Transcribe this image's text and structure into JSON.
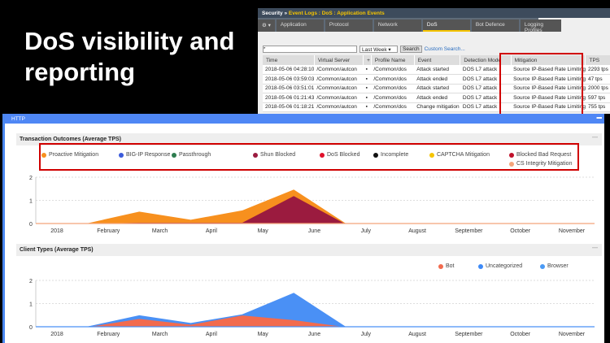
{
  "slide_title": "DoS visibility and reporting",
  "console": {
    "breadcrumb_root": "Security",
    "breadcrumb_sep": "»",
    "breadcrumb_path": "Event Logs : DoS : Application Events",
    "tabs": [
      "Application",
      "Protocol",
      "Network",
      "DoS",
      "Bot Defence",
      "Logging Profiles"
    ],
    "active_tab": "DoS",
    "gear": "⚙ ▾",
    "search_value": "*",
    "period": "Last Week ▾",
    "search_label": "Search",
    "custom_search": "Custom Search...",
    "columns": [
      "Time",
      "Virtual Server",
      "+",
      "Profile Name",
      "Event",
      "Detection Mode",
      "Mitigation",
      "TPS"
    ],
    "rows": [
      [
        "2018-05-06 04:28:10",
        "/Common/autcon",
        "/Common/dos",
        "Attack started",
        "DOS L7 attack",
        "Source IP-Based Rate Limiting",
        "2293 tps"
      ],
      [
        "2018-05-06 03:59:03",
        "/Common/autcon",
        "/Common/dos",
        "Attack ended",
        "DOS L7 attack",
        "Source IP-Based Rate Limiting",
        "47 tps"
      ],
      [
        "2018-05-06 03:51:01",
        "/Common/autcon",
        "/Common/dos",
        "Attack started",
        "DOS L7 attack",
        "Source IP-Based Rate Limiting",
        "2000 tps"
      ],
      [
        "2018-05-06 01:21:43",
        "/Common/autcon",
        "/Common/dos",
        "Attack ended",
        "DOS L7 attack",
        "Source IP-Based Rate Limiting",
        "597 tps"
      ],
      [
        "2018-05-06 01:18:21",
        "/Common/autcon",
        "/Common/dos",
        "Change mitigation",
        "DOS L7 attack",
        "Source IP-Based Rate Limiting",
        "755 tps"
      ]
    ]
  },
  "panel": {
    "title": "HTTP",
    "collapse": "▬"
  },
  "chart_data": [
    {
      "type": "area",
      "title": "Transaction Outcomes (Average TPS)",
      "stacked": true,
      "x_ticks": [
        "2018",
        "February",
        "March",
        "April",
        "May",
        "June",
        "July",
        "August",
        "September",
        "October",
        "November"
      ],
      "y_ticks": [
        "0",
        "1",
        "2"
      ],
      "ylim": [
        0,
        2
      ],
      "x": [
        0.6,
        1.6,
        2.6,
        3.6,
        4.6,
        5.6
      ],
      "legend": [
        {
          "name": "Proactive Mitigation",
          "color": "#f7901e"
        },
        {
          "name": "BIG-IP Response",
          "color": "#3b5bdb"
        },
        {
          "name": "Passthrough",
          "color": "#2e7d4f"
        },
        {
          "name": "Shun Blocked",
          "color": "#9b1b3f"
        },
        {
          "name": "DoS Blocked",
          "color": "#e0102a"
        },
        {
          "name": "Incomplete",
          "color": "#111111"
        },
        {
          "name": "CAPTCHA Mitigation",
          "color": "#f5c400"
        },
        {
          "name": "Blocked Bad Request",
          "color": "#c0102a"
        },
        {
          "name": "CS Integrity Mitigation",
          "color": "#f4a57a"
        }
      ],
      "series": [
        {
          "name": "Shun Blocked",
          "color": "#9b1b3f",
          "values": [
            0,
            0.05,
            0.05,
            0.05,
            1.2,
            0
          ]
        },
        {
          "name": "Proactive Mitigation",
          "color": "#f7901e",
          "values": [
            0,
            0.45,
            0.1,
            0.5,
            0.25,
            0
          ]
        }
      ]
    },
    {
      "type": "area",
      "title": "Client Types (Average TPS)",
      "stacked": true,
      "x_ticks": [
        "2018",
        "February",
        "March",
        "April",
        "May",
        "June",
        "July",
        "August",
        "September",
        "October",
        "November"
      ],
      "y_ticks": [
        "0",
        "1",
        "2"
      ],
      "ylim": [
        0,
        2
      ],
      "x": [
        0.6,
        1.6,
        2.6,
        3.6,
        4.6,
        5.6
      ],
      "legend": [
        {
          "name": "Bot",
          "color": "#f26b4e"
        },
        {
          "name": "Uncategorized",
          "color": "#3d8af7"
        },
        {
          "name": "Browser",
          "color": "#4a9af5"
        }
      ],
      "series": [
        {
          "name": "Bot",
          "color": "#f26b4e",
          "values": [
            0,
            0.35,
            0.1,
            0.5,
            0.3,
            0
          ]
        },
        {
          "name": "Browser",
          "color": "#4a90f5",
          "values": [
            0,
            0.13,
            0.05,
            0.02,
            1.15,
            0
          ]
        }
      ]
    }
  ]
}
